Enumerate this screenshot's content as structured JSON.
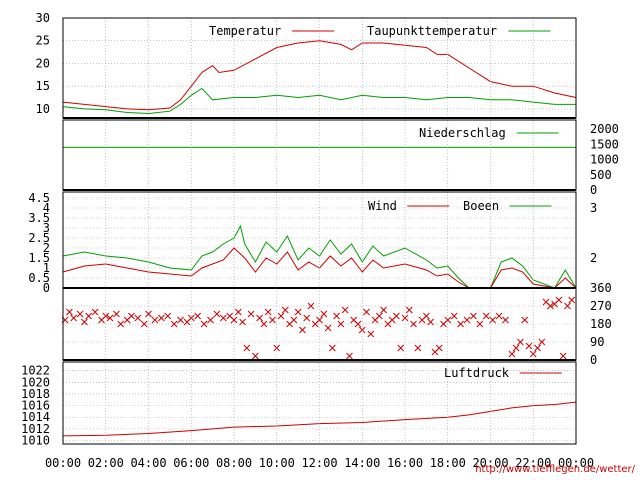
{
  "credit": "http://www.tiefflegen.de/wetter/",
  "colors": {
    "red": "#d00000",
    "green": "#00a000",
    "grid": "#a0a0a0"
  },
  "chart_data": [
    {
      "type": "line",
      "y_ticks": [
        "10",
        "15",
        "20",
        "25",
        "30"
      ],
      "ylim": [
        8,
        30
      ],
      "grid": true,
      "legend_position": "top-right",
      "series": [
        {
          "name": "Temperatur",
          "color": "#d00000",
          "x": [
            0,
            1,
            2,
            3,
            4,
            5,
            5.5,
            6,
            6.5,
            7,
            7.3,
            8,
            9,
            10,
            11,
            12,
            13,
            13.5,
            14,
            15,
            16,
            17,
            17.5,
            18,
            19,
            20,
            21,
            22,
            23,
            24
          ],
          "y": [
            11.5,
            11,
            10.5,
            10,
            9.8,
            10.2,
            12,
            15,
            18,
            19.5,
            18,
            18.5,
            21,
            23.5,
            24.5,
            25,
            24.2,
            23,
            24.5,
            24.5,
            24,
            23.5,
            22,
            22,
            19,
            16,
            15,
            15,
            13.5,
            12.5
          ]
        },
        {
          "name": "Taupunkttemperatur",
          "color": "#00a000",
          "x": [
            0,
            1,
            2,
            3,
            4,
            5,
            5.5,
            6,
            6.5,
            7,
            8,
            9,
            10,
            11,
            12,
            13,
            14,
            15,
            16,
            17,
            18,
            19,
            20,
            21,
            22,
            23,
            24
          ],
          "y": [
            10.5,
            10,
            9.8,
            9.2,
            9,
            9.5,
            11,
            13,
            14.5,
            12,
            12.5,
            12.5,
            13,
            12.5,
            13,
            12,
            13,
            12.5,
            12.5,
            12,
            12.5,
            12.5,
            12,
            12,
            11.5,
            11,
            11
          ]
        }
      ]
    },
    {
      "type": "line",
      "y_ticks": [
        "0",
        "500",
        "1000",
        "1500",
        "2000"
      ],
      "ylim": [
        0,
        2300
      ],
      "legend_position": "top-right",
      "series": [
        {
          "name": "Niederschlag",
          "color": "#00a000",
          "x": [
            0,
            24
          ],
          "y": [
            1400,
            1400
          ]
        }
      ]
    },
    {
      "type": "line",
      "y_ticks": [
        "0",
        "0.5",
        "1",
        "1.5",
        "2",
        "2.5",
        "3",
        "3.5",
        "4",
        "4.5"
      ],
      "y2_ticks": [
        "2",
        "3"
      ],
      "ylim": [
        0,
        4.8
      ],
      "grid": true,
      "legend_position": "top-right",
      "series": [
        {
          "name": "Wind",
          "color": "#d00000",
          "x": [
            0,
            1,
            2,
            3,
            4,
            5,
            6,
            6.5,
            7,
            7.5,
            8,
            8.5,
            9,
            9.5,
            10,
            10.5,
            11,
            11.5,
            12,
            12.5,
            13,
            13.5,
            14,
            14.5,
            15,
            16,
            17,
            17.5,
            18,
            18.5,
            19,
            19.5,
            20,
            20.5,
            21,
            21.5,
            22,
            23,
            23.5,
            24
          ],
          "y": [
            0.8,
            1.1,
            1.2,
            1.0,
            0.8,
            0.7,
            0.6,
            1.0,
            1.2,
            1.4,
            2.0,
            1.5,
            0.8,
            1.5,
            1.2,
            1.8,
            0.9,
            1.3,
            1.0,
            1.6,
            1.1,
            1.5,
            0.8,
            1.4,
            1.0,
            1.2,
            0.9,
            0.6,
            0.7,
            0.3,
            0,
            0,
            0,
            0.9,
            1.0,
            0.8,
            0.2,
            0,
            0.5,
            0
          ]
        },
        {
          "name": "Boeen",
          "color": "#00a000",
          "x": [
            0,
            1,
            2,
            3,
            4,
            5,
            6,
            6.5,
            7,
            7.5,
            8,
            8.3,
            8.5,
            9,
            9.5,
            10,
            10.5,
            11,
            11.5,
            12,
            12.5,
            13,
            13.5,
            14,
            14.5,
            15,
            16,
            17,
            17.5,
            18,
            18.5,
            19,
            19.5,
            20,
            20.5,
            21,
            21.5,
            22,
            23,
            23.5,
            24
          ],
          "y": [
            1.6,
            1.8,
            1.6,
            1.5,
            1.3,
            1.0,
            0.9,
            1.6,
            1.8,
            2.2,
            2.5,
            3.1,
            2.2,
            1.3,
            2.3,
            1.8,
            2.6,
            1.4,
            2.0,
            1.6,
            2.4,
            1.7,
            2.2,
            1.3,
            2.1,
            1.6,
            2.0,
            1.4,
            1.0,
            1.1,
            0.5,
            0,
            0,
            0,
            1.3,
            1.5,
            1.1,
            0.4,
            0,
            0.9,
            0
          ]
        }
      ]
    },
    {
      "type": "scatter",
      "y2_ticks": [
        "0",
        "90",
        "180",
        "270",
        "360"
      ],
      "ylim": [
        0,
        360
      ],
      "grid": true,
      "marker": "x",
      "x": [
        0.1,
        0.3,
        0.5,
        0.8,
        1.0,
        1.2,
        1.5,
        1.8,
        2.0,
        2.2,
        2.5,
        2.7,
        3.0,
        3.2,
        3.5,
        3.8,
        4.0,
        4.3,
        4.6,
        4.9,
        5.2,
        5.5,
        5.8,
        6.0,
        6.3,
        6.6,
        6.9,
        7.2,
        7.5,
        7.8,
        8.0,
        8.2,
        8.4,
        8.6,
        8.8,
        9.0,
        9.2,
        9.4,
        9.6,
        9.8,
        10.0,
        10.2,
        10.4,
        10.6,
        10.8,
        11.0,
        11.2,
        11.4,
        11.6,
        11.8,
        12.0,
        12.2,
        12.4,
        12.6,
        12.8,
        13.0,
        13.2,
        13.4,
        13.6,
        13.8,
        14.0,
        14.2,
        14.4,
        14.6,
        14.8,
        15.0,
        15.2,
        15.4,
        15.6,
        15.8,
        16.0,
        16.2,
        16.4,
        16.6,
        16.8,
        17.0,
        17.2,
        17.4,
        17.6,
        17.8,
        18.0,
        18.3,
        18.6,
        18.9,
        19.2,
        19.5,
        19.8,
        20.1,
        20.4,
        20.7,
        21.0,
        21.2,
        21.4,
        21.6,
        21.8,
        22.0,
        22.2,
        22.4,
        22.6,
        22.8,
        23.0,
        23.2,
        23.4,
        23.6,
        23.8
      ],
      "y": [
        200,
        240,
        210,
        230,
        190,
        220,
        240,
        200,
        220,
        210,
        230,
        180,
        200,
        220,
        210,
        180,
        230,
        200,
        210,
        220,
        180,
        200,
        190,
        210,
        220,
        180,
        200,
        230,
        210,
        220,
        200,
        240,
        190,
        60,
        230,
        20,
        210,
        180,
        240,
        200,
        60,
        220,
        250,
        180,
        200,
        240,
        150,
        210,
        270,
        180,
        200,
        230,
        160,
        60,
        220,
        180,
        250,
        20,
        200,
        180,
        150,
        240,
        130,
        200,
        220,
        250,
        180,
        200,
        220,
        60,
        210,
        250,
        180,
        60,
        200,
        220,
        190,
        40,
        60,
        180,
        200,
        220,
        180,
        200,
        220,
        180,
        220,
        200,
        220,
        200,
        30,
        60,
        90,
        200,
        70,
        30,
        60,
        90,
        290,
        270,
        280,
        300,
        20,
        270,
        300
      ]
    },
    {
      "type": "line",
      "y_ticks": [
        "1010",
        "1012",
        "1014",
        "1016",
        "1018",
        "1020",
        "1022"
      ],
      "ylim": [
        1009.4,
        1023.5
      ],
      "grid": true,
      "legend_position": "top-right",
      "series": [
        {
          "name": "Luftdruck",
          "color": "#d00000",
          "x": [
            0,
            2,
            4,
            6,
            8,
            10,
            12,
            14,
            16,
            18,
            19,
            20,
            21,
            22,
            23,
            24
          ],
          "y": [
            1010.8,
            1010.9,
            1011.2,
            1011.7,
            1012.3,
            1012.5,
            1012.9,
            1013.1,
            1013.6,
            1014.0,
            1014.4,
            1015.0,
            1015.6,
            1016.0,
            1016.2,
            1016.6
          ]
        }
      ]
    }
  ],
  "x_ticks": [
    "00:00",
    "02:00",
    "04:00",
    "06:00",
    "08:00",
    "10:00",
    "12:00",
    "14:00",
    "16:00",
    "18:00",
    "20:00",
    "22:00",
    "00:00"
  ]
}
